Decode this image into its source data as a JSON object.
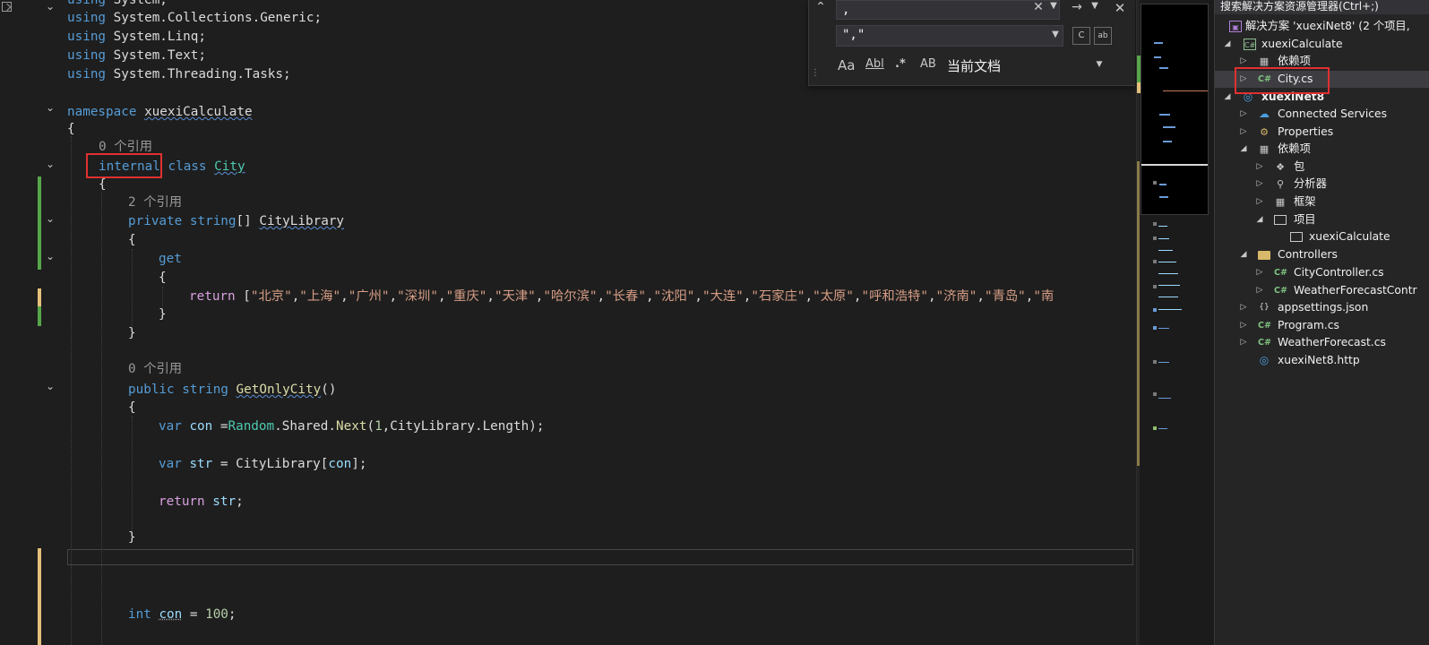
{
  "editor": {
    "lines": {
      "l0": [
        "using System;"
      ],
      "using1": "using",
      "using1_ns": "System.Collections.Generic;",
      "using2": "using",
      "using2_ns": "System.Linq;",
      "using3": "using",
      "using3_ns": "System.Text;",
      "using4": "using",
      "using4_ns": "System.Threading.Tasks;",
      "using0": "using",
      "using0_ns": "System;",
      "namespace_kw": "namespace",
      "namespace_name": "xuexiCalculate",
      "open_brace": "{",
      "lens_class": "0 个引用",
      "internal_kw": "internal",
      "class_kw": "class",
      "class_name": "City",
      "class_open": "{",
      "lens_prop": "2 个引用",
      "private_kw": "private",
      "string_kw": "string",
      "array_brackets": "[]",
      "prop_name": "CityLibrary",
      "prop_open": "{",
      "get_kw": "get",
      "get_open": "{",
      "return_kw": "return",
      "return_open": "[",
      "cities": [
        "\"北京\"",
        "\"上海\"",
        "\"广州\"",
        "\"深圳\"",
        "\"重庆\"",
        "\"天津\"",
        "\"哈尔滨\"",
        "\"长春\"",
        "\"沈阳\"",
        "\"大连\"",
        "\"石家庄\"",
        "\"太原\"",
        "\"呼和浩特\"",
        "\"济南\"",
        "\"青岛\"",
        "\"南"
      ],
      "get_close": "}",
      "prop_close": "}",
      "lens_method": "0 个引用",
      "public_kw": "public",
      "string_kw2": "string",
      "method_name": "GetOnlyCity",
      "method_parens": "()",
      "method_open": "{",
      "var_kw": "var",
      "con_var": "con",
      "assign": " =",
      "random_type": "Random",
      "shared": ".Shared.",
      "next_meth": "Next",
      "next_args_open": "(",
      "next_num": "1",
      "next_rest": ",CityLibrary.Length);",
      "var_kw2": "var",
      "str_var": "str",
      "str_assign": " = CityLibrary[",
      "str_idx": "con",
      "str_end": "];",
      "return_kw2": "return",
      "return_var": "str",
      "return_semi": ";",
      "method_close": "}",
      "int_kw": "int",
      "con_var2": "con",
      "int_assign": " = ",
      "int_num": "100",
      "int_semi": ";"
    }
  },
  "find_widget": {
    "search_value": ",",
    "replace_value": "\",\"",
    "scope": "当前文档",
    "opt_match_case": "Aa",
    "opt_whole_word": "Abl",
    "opt_regex": ".*",
    "opt_preserve_case": "AB"
  },
  "solution_explorer": {
    "search_placeholder": "搜索解决方案资源管理器(Ctrl+;)",
    "rows": [
      {
        "label": "解决方案 'xuexiNet8' (2 个项目,",
        "icon": "solution-icon"
      },
      {
        "label": "xuexiCalculate",
        "icon": "csharp-project-icon"
      },
      {
        "label": "依赖项",
        "icon": "dependencies-icon"
      },
      {
        "label": "City.cs",
        "icon": "csharp-file-icon"
      },
      {
        "label": "xuexiNet8",
        "icon": "web-project-icon"
      },
      {
        "label": "Connected Services",
        "icon": "connected-services-icon"
      },
      {
        "label": "Properties",
        "icon": "properties-icon"
      },
      {
        "label": "依赖项",
        "icon": "dependencies-icon"
      },
      {
        "label": "包",
        "icon": "package-icon"
      },
      {
        "label": "分析器",
        "icon": "analyzer-icon"
      },
      {
        "label": "框架",
        "icon": "framework-icon"
      },
      {
        "label": "项目",
        "icon": "project-ref-icon"
      },
      {
        "label": "xuexiCalculate",
        "icon": "project-ref-icon"
      },
      {
        "label": "Controllers",
        "icon": "folder-icon"
      },
      {
        "label": "CityController.cs",
        "icon": "csharp-file-icon"
      },
      {
        "label": "WeatherForecastContr",
        "icon": "csharp-file-icon"
      },
      {
        "label": "appsettings.json",
        "icon": "json-file-icon"
      },
      {
        "label": "Program.cs",
        "icon": "csharp-file-icon"
      },
      {
        "label": "WeatherForecast.cs",
        "icon": "csharp-file-icon"
      },
      {
        "label": "xuexiNet8.http",
        "icon": "http-file-icon"
      }
    ]
  },
  "colors": {
    "editor_bg": "#1e1e1e",
    "keyword": "#569cd6",
    "control_keyword": "#d8a0df",
    "type": "#4ec9b0",
    "method": "#dcdcaa",
    "string": "#d69d85",
    "number": "#b5cea8",
    "highlight_box": "#e03030",
    "change_bar": "#57a64a",
    "change_bar_unsaved": "#e5c07b"
  }
}
